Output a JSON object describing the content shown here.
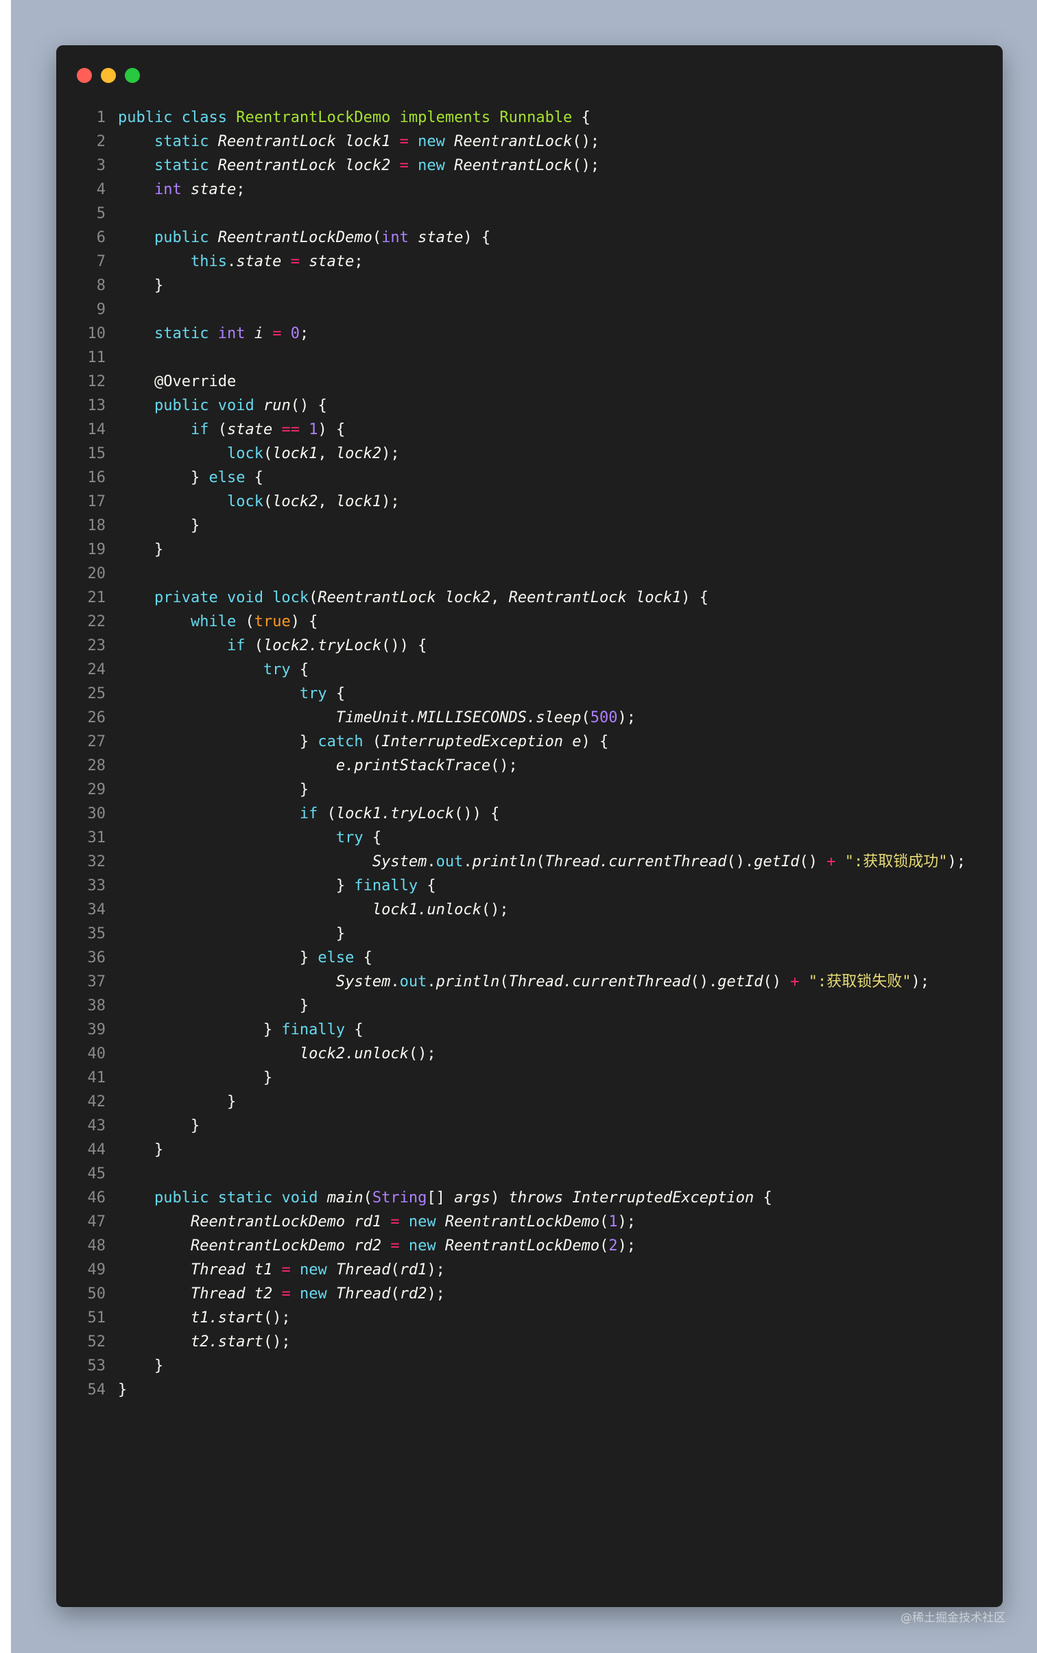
{
  "window": {
    "controls": {
      "close_color": "#ff5f57",
      "minimize_color": "#febc2e",
      "maximize_color": "#28c840"
    }
  },
  "palette": {
    "background": "#1e1e1e",
    "keyword": "#66d9ef",
    "type": "#ae81ff",
    "class": "#a6e22e",
    "string": "#e6db74",
    "operator": "#f92672"
  },
  "code": {
    "lines": [
      [
        [
          "kw",
          "public"
        ],
        [
          "p",
          " "
        ],
        [
          "kw",
          "class"
        ],
        [
          "p",
          " "
        ],
        [
          "cls",
          "ReentrantLockDemo"
        ],
        [
          "p",
          " "
        ],
        [
          "cls",
          "implements"
        ],
        [
          "p",
          " "
        ],
        [
          "cls",
          "Runnable"
        ],
        [
          "p",
          " {"
        ]
      ],
      [
        [
          "p",
          "    "
        ],
        [
          "kw",
          "static"
        ],
        [
          "p",
          " "
        ],
        [
          "it",
          "ReentrantLock"
        ],
        [
          "p",
          " "
        ],
        [
          "it",
          "lock1"
        ],
        [
          "p",
          " "
        ],
        [
          "op",
          "="
        ],
        [
          "p",
          " "
        ],
        [
          "kw",
          "new"
        ],
        [
          "p",
          " "
        ],
        [
          "it",
          "ReentrantLock"
        ],
        [
          "p",
          "();"
        ]
      ],
      [
        [
          "p",
          "    "
        ],
        [
          "kw",
          "static"
        ],
        [
          "p",
          " "
        ],
        [
          "it",
          "ReentrantLock"
        ],
        [
          "p",
          " "
        ],
        [
          "it",
          "lock2"
        ],
        [
          "p",
          " "
        ],
        [
          "op",
          "="
        ],
        [
          "p",
          " "
        ],
        [
          "kw",
          "new"
        ],
        [
          "p",
          " "
        ],
        [
          "it",
          "ReentrantLock"
        ],
        [
          "p",
          "();"
        ]
      ],
      [
        [
          "p",
          "    "
        ],
        [
          "type",
          "int"
        ],
        [
          "p",
          " "
        ],
        [
          "it",
          "state"
        ],
        [
          "p",
          ";"
        ]
      ],
      [],
      [
        [
          "p",
          "    "
        ],
        [
          "kw",
          "public"
        ],
        [
          "p",
          " "
        ],
        [
          "it",
          "ReentrantLockDemo"
        ],
        [
          "p",
          "("
        ],
        [
          "type",
          "int"
        ],
        [
          "p",
          " "
        ],
        [
          "it",
          "state"
        ],
        [
          "p",
          ") {"
        ]
      ],
      [
        [
          "p",
          "        "
        ],
        [
          "kw",
          "this"
        ],
        [
          "p",
          "."
        ],
        [
          "it",
          "state"
        ],
        [
          "p",
          " "
        ],
        [
          "op",
          "="
        ],
        [
          "p",
          " "
        ],
        [
          "it",
          "state"
        ],
        [
          "p",
          ";"
        ]
      ],
      [
        [
          "p",
          "    }"
        ]
      ],
      [],
      [
        [
          "p",
          "    "
        ],
        [
          "kw",
          "static"
        ],
        [
          "p",
          " "
        ],
        [
          "type",
          "int"
        ],
        [
          "p",
          " "
        ],
        [
          "it",
          "i"
        ],
        [
          "p",
          " "
        ],
        [
          "op",
          "="
        ],
        [
          "p",
          " "
        ],
        [
          "num",
          "0"
        ],
        [
          "p",
          ";"
        ]
      ],
      [],
      [
        [
          "p",
          "    @Override"
        ]
      ],
      [
        [
          "p",
          "    "
        ],
        [
          "kw",
          "public"
        ],
        [
          "p",
          " "
        ],
        [
          "kw",
          "void"
        ],
        [
          "p",
          " "
        ],
        [
          "it",
          "run"
        ],
        [
          "p",
          "() {"
        ]
      ],
      [
        [
          "p",
          "        "
        ],
        [
          "kw",
          "if"
        ],
        [
          "p",
          " ("
        ],
        [
          "it",
          "state"
        ],
        [
          "p",
          " "
        ],
        [
          "op",
          "=="
        ],
        [
          "p",
          " "
        ],
        [
          "num",
          "1"
        ],
        [
          "p",
          ") {"
        ]
      ],
      [
        [
          "p",
          "            "
        ],
        [
          "kw",
          "lock"
        ],
        [
          "p",
          "("
        ],
        [
          "it",
          "lock1"
        ],
        [
          "p",
          ", "
        ],
        [
          "it",
          "lock2"
        ],
        [
          "p",
          ");"
        ]
      ],
      [
        [
          "p",
          "        } "
        ],
        [
          "kw",
          "else"
        ],
        [
          "p",
          " {"
        ]
      ],
      [
        [
          "p",
          "            "
        ],
        [
          "kw",
          "lock"
        ],
        [
          "p",
          "("
        ],
        [
          "it",
          "lock2"
        ],
        [
          "p",
          ", "
        ],
        [
          "it",
          "lock1"
        ],
        [
          "p",
          ");"
        ]
      ],
      [
        [
          "p",
          "        }"
        ]
      ],
      [
        [
          "p",
          "    }"
        ]
      ],
      [],
      [
        [
          "p",
          "    "
        ],
        [
          "kw",
          "private"
        ],
        [
          "p",
          " "
        ],
        [
          "kw",
          "void"
        ],
        [
          "p",
          " "
        ],
        [
          "kw",
          "lock"
        ],
        [
          "p",
          "("
        ],
        [
          "it",
          "ReentrantLock"
        ],
        [
          "p",
          " "
        ],
        [
          "it",
          "lock2"
        ],
        [
          "p",
          ", "
        ],
        [
          "it",
          "ReentrantLock"
        ],
        [
          "p",
          " "
        ],
        [
          "it",
          "lock1"
        ],
        [
          "p",
          ") {"
        ]
      ],
      [
        [
          "p",
          "        "
        ],
        [
          "kw",
          "while"
        ],
        [
          "p",
          " ("
        ],
        [
          "bool",
          "true"
        ],
        [
          "p",
          ") {"
        ]
      ],
      [
        [
          "p",
          "            "
        ],
        [
          "kw",
          "if"
        ],
        [
          "p",
          " ("
        ],
        [
          "it",
          "lock2.tryLock"
        ],
        [
          "p",
          "()) {"
        ]
      ],
      [
        [
          "p",
          "                "
        ],
        [
          "kw",
          "try"
        ],
        [
          "p",
          " {"
        ]
      ],
      [
        [
          "p",
          "                    "
        ],
        [
          "kw",
          "try"
        ],
        [
          "p",
          " {"
        ]
      ],
      [
        [
          "p",
          "                        "
        ],
        [
          "it",
          "TimeUnit.MILLISECONDS.sleep"
        ],
        [
          "p",
          "("
        ],
        [
          "num",
          "500"
        ],
        [
          "p",
          ");"
        ]
      ],
      [
        [
          "p",
          "                    } "
        ],
        [
          "kw",
          "catch"
        ],
        [
          "p",
          " ("
        ],
        [
          "it",
          "InterruptedException e"
        ],
        [
          "p",
          ") {"
        ]
      ],
      [
        [
          "p",
          "                        "
        ],
        [
          "it",
          "e.printStackTrace"
        ],
        [
          "p",
          "();"
        ]
      ],
      [
        [
          "p",
          "                    }"
        ]
      ],
      [
        [
          "p",
          "                    "
        ],
        [
          "kw",
          "if"
        ],
        [
          "p",
          " ("
        ],
        [
          "it",
          "lock1.tryLock"
        ],
        [
          "p",
          "()) {"
        ]
      ],
      [
        [
          "p",
          "                        "
        ],
        [
          "kw",
          "try"
        ],
        [
          "p",
          " {"
        ]
      ],
      [
        [
          "p",
          "                            "
        ],
        [
          "it",
          "System"
        ],
        [
          "p",
          "."
        ],
        [
          "kw",
          "out"
        ],
        [
          "p",
          "."
        ],
        [
          "it",
          "println"
        ],
        [
          "p",
          "("
        ],
        [
          "it",
          "Thread.currentThread"
        ],
        [
          "p",
          "()."
        ],
        [
          "it",
          "getId"
        ],
        [
          "p",
          "() "
        ],
        [
          "op",
          "+"
        ],
        [
          "p",
          " "
        ],
        [
          "str",
          "\":获取锁成功\""
        ],
        [
          "p",
          ");"
        ]
      ],
      [
        [
          "p",
          "                        } "
        ],
        [
          "kw",
          "finally"
        ],
        [
          "p",
          " {"
        ]
      ],
      [
        [
          "p",
          "                            "
        ],
        [
          "it",
          "lock1.unlock"
        ],
        [
          "p",
          "();"
        ]
      ],
      [
        [
          "p",
          "                        }"
        ]
      ],
      [
        [
          "p",
          "                    } "
        ],
        [
          "kw",
          "else"
        ],
        [
          "p",
          " {"
        ]
      ],
      [
        [
          "p",
          "                        "
        ],
        [
          "it",
          "System"
        ],
        [
          "p",
          "."
        ],
        [
          "kw",
          "out"
        ],
        [
          "p",
          "."
        ],
        [
          "it",
          "println"
        ],
        [
          "p",
          "("
        ],
        [
          "it",
          "Thread.currentThread"
        ],
        [
          "p",
          "()."
        ],
        [
          "it",
          "getId"
        ],
        [
          "p",
          "() "
        ],
        [
          "op",
          "+"
        ],
        [
          "p",
          " "
        ],
        [
          "str",
          "\":获取锁失败\""
        ],
        [
          "p",
          ");"
        ]
      ],
      [
        [
          "p",
          "                    }"
        ]
      ],
      [
        [
          "p",
          "                } "
        ],
        [
          "kw",
          "finally"
        ],
        [
          "p",
          " {"
        ]
      ],
      [
        [
          "p",
          "                    "
        ],
        [
          "it",
          "lock2.unlock"
        ],
        [
          "p",
          "();"
        ]
      ],
      [
        [
          "p",
          "                }"
        ]
      ],
      [
        [
          "p",
          "            }"
        ]
      ],
      [
        [
          "p",
          "        }"
        ]
      ],
      [
        [
          "p",
          "    }"
        ]
      ],
      [],
      [
        [
          "p",
          "    "
        ],
        [
          "kw",
          "public"
        ],
        [
          "p",
          " "
        ],
        [
          "kw",
          "static"
        ],
        [
          "p",
          " "
        ],
        [
          "kw",
          "void"
        ],
        [
          "p",
          " "
        ],
        [
          "it",
          "main"
        ],
        [
          "p",
          "("
        ],
        [
          "type",
          "String"
        ],
        [
          "p",
          "[] "
        ],
        [
          "it",
          "args"
        ],
        [
          "p",
          ") "
        ],
        [
          "it",
          "throws"
        ],
        [
          "p",
          " "
        ],
        [
          "it",
          "InterruptedException"
        ],
        [
          "p",
          " {"
        ]
      ],
      [
        [
          "p",
          "        "
        ],
        [
          "it",
          "ReentrantLockDemo"
        ],
        [
          "p",
          " "
        ],
        [
          "it",
          "rd1"
        ],
        [
          "p",
          " "
        ],
        [
          "op",
          "="
        ],
        [
          "p",
          " "
        ],
        [
          "kw",
          "new"
        ],
        [
          "p",
          " "
        ],
        [
          "it",
          "ReentrantLockDemo"
        ],
        [
          "p",
          "("
        ],
        [
          "num",
          "1"
        ],
        [
          "p",
          ");"
        ]
      ],
      [
        [
          "p",
          "        "
        ],
        [
          "it",
          "ReentrantLockDemo"
        ],
        [
          "p",
          " "
        ],
        [
          "it",
          "rd2"
        ],
        [
          "p",
          " "
        ],
        [
          "op",
          "="
        ],
        [
          "p",
          " "
        ],
        [
          "kw",
          "new"
        ],
        [
          "p",
          " "
        ],
        [
          "it",
          "ReentrantLockDemo"
        ],
        [
          "p",
          "("
        ],
        [
          "num",
          "2"
        ],
        [
          "p",
          ");"
        ]
      ],
      [
        [
          "p",
          "        "
        ],
        [
          "it",
          "Thread"
        ],
        [
          "p",
          " "
        ],
        [
          "it",
          "t1"
        ],
        [
          "p",
          " "
        ],
        [
          "op",
          "="
        ],
        [
          "p",
          " "
        ],
        [
          "kw",
          "new"
        ],
        [
          "p",
          " "
        ],
        [
          "it",
          "Thread"
        ],
        [
          "p",
          "("
        ],
        [
          "it",
          "rd1"
        ],
        [
          "p",
          ");"
        ]
      ],
      [
        [
          "p",
          "        "
        ],
        [
          "it",
          "Thread"
        ],
        [
          "p",
          " "
        ],
        [
          "it",
          "t2"
        ],
        [
          "p",
          " "
        ],
        [
          "op",
          "="
        ],
        [
          "p",
          " "
        ],
        [
          "kw",
          "new"
        ],
        [
          "p",
          " "
        ],
        [
          "it",
          "Thread"
        ],
        [
          "p",
          "("
        ],
        [
          "it",
          "rd2"
        ],
        [
          "p",
          ");"
        ]
      ],
      [
        [
          "p",
          "        "
        ],
        [
          "it",
          "t1.start"
        ],
        [
          "p",
          "();"
        ]
      ],
      [
        [
          "p",
          "        "
        ],
        [
          "it",
          "t2.start"
        ],
        [
          "p",
          "();"
        ]
      ],
      [
        [
          "p",
          "    }"
        ]
      ],
      [
        [
          "p",
          "}"
        ]
      ]
    ]
  },
  "watermark": "@稀土掘金技术社区"
}
